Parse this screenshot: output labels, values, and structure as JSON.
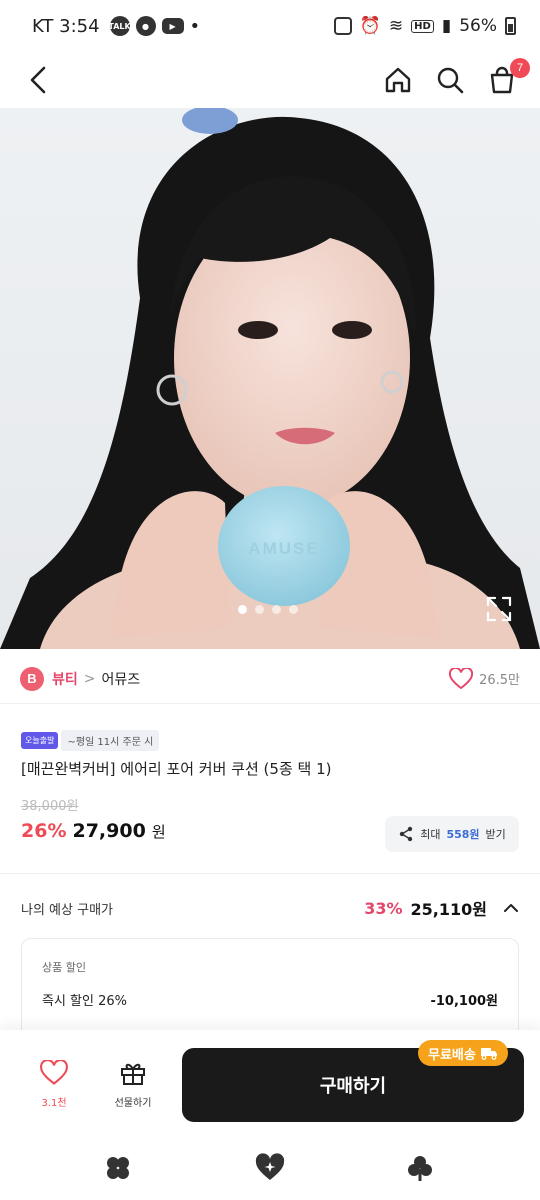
{
  "status_bar": {
    "carrier_time": "KT 3:54",
    "app_icons": [
      "talk-icon",
      "chat-icon",
      "youtube-icon"
    ],
    "dot": "•",
    "hd": "HD",
    "battery": "56%"
  },
  "header": {
    "icons": [
      "back-icon",
      "home-icon",
      "search-icon",
      "cart-icon"
    ],
    "cart_count": "7"
  },
  "hero": {
    "product_brand_on_compact": "AMUSE",
    "slide_count": 4,
    "active_slide": 1
  },
  "brand": {
    "badge": "B",
    "category": "뷰티",
    "separator": ">",
    "name": "어뮤즈",
    "likes": "26.5만"
  },
  "product": {
    "badge_today": "오늘출발",
    "badge_cutoff": "~평일 11시 주문 시",
    "title": "[매끈완벽커버] 에어리 포어 커버 쿠션 (5종 택 1)",
    "original_price": "38,000원",
    "discount_rate": "26%",
    "sale_price": "27,900",
    "won": "원",
    "share": {
      "prefix": "최대",
      "amount": "558원",
      "suffix": "받기"
    }
  },
  "expected": {
    "label": "나의 예상 구매가",
    "rate": "33%",
    "price": "25,110원"
  },
  "discount_detail": {
    "title": "상품 할인",
    "item_label": "즉시 할인 26%",
    "item_value": "-10,100원"
  },
  "actions": {
    "wish_count": "3.1천",
    "gift_label": "선물하기",
    "buy_label": "구매하기",
    "free_shipping": "무료배송"
  },
  "colors": {
    "accent_red": "#ef4a55",
    "brand_pink": "#e5476b",
    "buy_button": "#1a1a1a",
    "free_ship": "#f6a31b",
    "today_badge": "#6158ea"
  }
}
